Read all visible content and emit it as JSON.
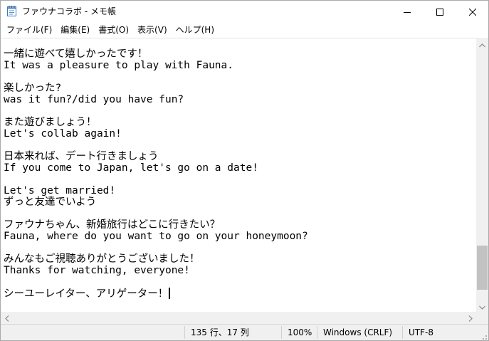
{
  "window": {
    "title": "ファウナコラボ - メモ帳",
    "icon": "notepad-icon"
  },
  "controls": {
    "minimize_icon": "minimize-icon",
    "maximize_icon": "maximize-icon",
    "close_icon": "close-icon"
  },
  "menu": {
    "items": [
      {
        "label": "ファイル(F)"
      },
      {
        "label": "編集(E)"
      },
      {
        "label": "書式(O)"
      },
      {
        "label": "表示(V)"
      },
      {
        "label": "ヘルプ(H)"
      }
    ]
  },
  "editor": {
    "lines": [
      "一緒に遊べて嬉しかったです！",
      "It was a pleasure to play with Fauna.",
      "",
      "楽しかった?",
      "was it fun?/did you have fun?",
      "",
      "また遊びましょう！",
      "Let's collab again!",
      "",
      "日本来れば、デート行きましょう",
      "If you come to Japan, let's go on a date!",
      "",
      "Let's get married!",
      "ずっと友達でいよう",
      "",
      "ファウナちゃん、新婚旅行はどこに行きたい？",
      "Fauna, where do you want to go on your honeymoon?",
      "",
      "みんなもご視聴ありがとうございました！",
      "Thanks for watching, everyone!",
      "",
      "シーユーレイター、アリゲーター！"
    ],
    "vertical_scroll_position": 0.95
  },
  "status": {
    "position": "135 行、17 列",
    "zoom": "100%",
    "line_ending": "Windows (CRLF)",
    "encoding": "UTF-8"
  }
}
